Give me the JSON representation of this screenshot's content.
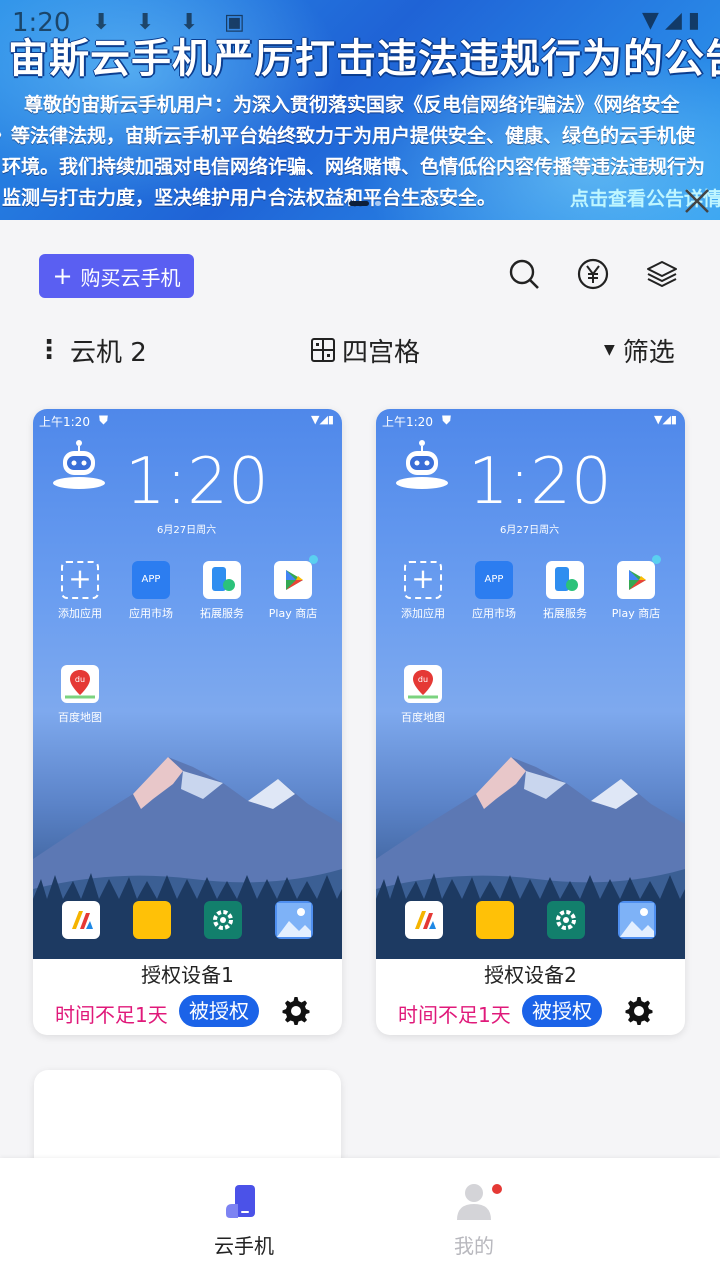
{
  "status_bar": {
    "time": "1:20"
  },
  "banner": {
    "title": "宙斯云手机严厉打击违法违规行为的公告",
    "lead": "尊敬的宙斯云手机用户：",
    "line1": "为深入贯彻落实国家《反电信网络诈骗法》《网络安全",
    "line2": "》等法律法规，宙斯云手机平台始终致力于为用户提供安全、健康、绿色的云手机使",
    "line3": "环境。我们持续加强对电信网络诈骗、网络赌博、色情低俗内容传播等违法违规行为",
    "line4": "监测与打击力度，坚决维护用户合法权益和平台生态安全。",
    "link": "点击查看公告详情"
  },
  "toolbar": {
    "buy_label": "购买云手机",
    "device_count_label": "云机 2",
    "grid_label": "四宫格",
    "filter_label": "筛选"
  },
  "devices": [
    {
      "status_time": "上午1:20",
      "clock": "1:20",
      "date": "6月27日周六",
      "apps": [
        "添加应用",
        "应用市场",
        "拓展服务",
        "Play 商店",
        "百度地图"
      ],
      "name": "授权设备1",
      "warning": "时间不足1天",
      "auth_label": "被授权"
    },
    {
      "status_time": "上午1:20",
      "clock": "1:20",
      "date": "6月27日周六",
      "apps": [
        "添加应用",
        "应用市场",
        "拓展服务",
        "Play 商店",
        "百度地图"
      ],
      "name": "授权设备2",
      "warning": "时间不足1天",
      "auth_label": "被授权"
    }
  ],
  "bottom_nav": {
    "items": [
      {
        "label": "云手机",
        "active": true
      },
      {
        "label": "我的",
        "active": false
      }
    ]
  },
  "colors": {
    "accent": "#5a5ff2",
    "auth": "#1b63e8",
    "warning": "#e0197a",
    "badge": "#e53935"
  }
}
